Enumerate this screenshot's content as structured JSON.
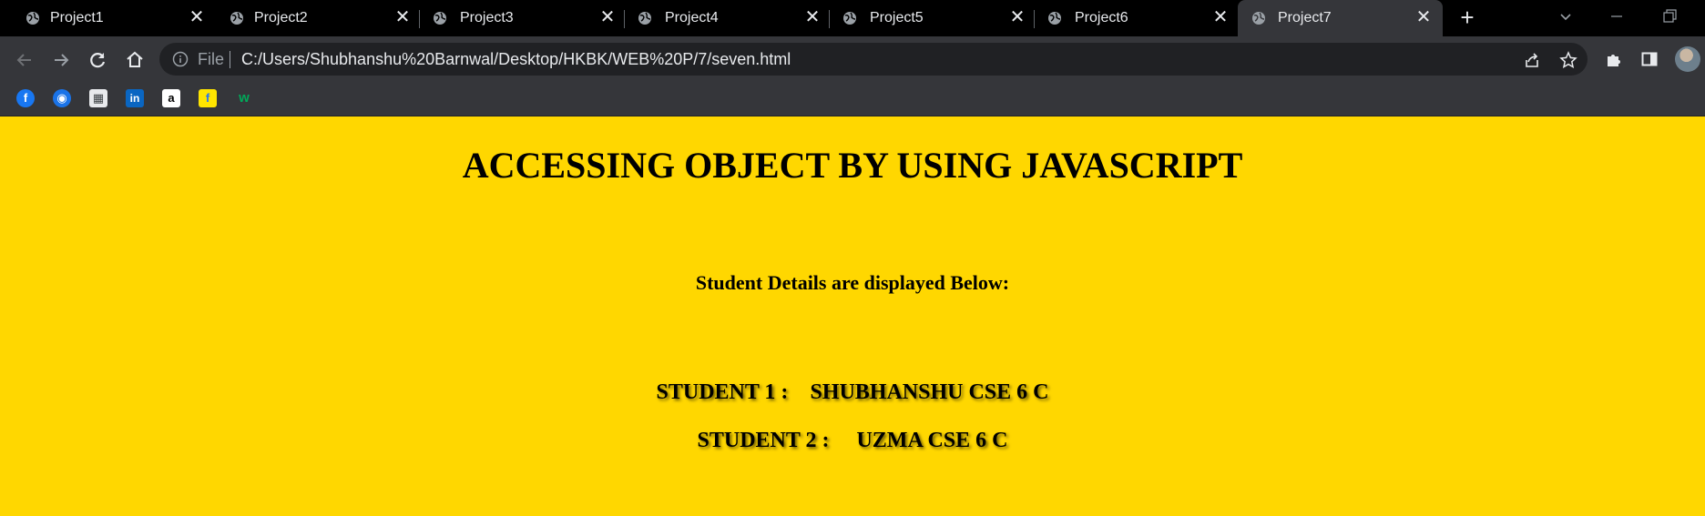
{
  "browser": {
    "tabs": [
      {
        "title": "Project1",
        "active": false
      },
      {
        "title": "Project2",
        "active": false
      },
      {
        "title": "Project3",
        "active": false
      },
      {
        "title": "Project4",
        "active": false
      },
      {
        "title": "Project5",
        "active": false
      },
      {
        "title": "Project6",
        "active": false
      },
      {
        "title": "Project7",
        "active": true
      }
    ],
    "new_tab_label": "+",
    "close_label": "✕",
    "address_bar": {
      "scheme_label": "File",
      "url": "C:/Users/Shubhanshu%20Barnwal/Desktop/HKBK/WEB%20P/7/seven.html"
    },
    "bookmarks": [
      {
        "icon": "facebook-icon",
        "glyph": "f",
        "color": "#1877f2"
      },
      {
        "icon": "bookmark-blue-icon",
        "glyph": "◉",
        "color": "#1a73e8"
      },
      {
        "icon": "bookmark-grid-icon",
        "glyph": "▦",
        "color": "#e8eaed"
      },
      {
        "icon": "linkedin-icon",
        "glyph": "in",
        "color": "#0a66c2"
      },
      {
        "icon": "amazon-icon",
        "glyph": "a",
        "color": "#ffffff"
      },
      {
        "icon": "flipkart-icon",
        "glyph": "f",
        "color": "#ffe500"
      },
      {
        "icon": "bookmark-w-icon",
        "glyph": "w",
        "color": "#00a859"
      }
    ],
    "colors": {
      "tabstrip": "#000000",
      "toolbar": "#35363a",
      "omnibox": "#202124",
      "page_background": "#ffd700"
    }
  },
  "page": {
    "heading": "ACCESSING OBJECT BY USING JAVASCRIPT",
    "subtext": "Student Details are displayed Below:",
    "students": [
      {
        "label": "STUDENT 1 :",
        "value": "SHUBHANSHU CSE 6 C"
      },
      {
        "label": "STUDENT 2 :",
        "value": "UZMA CSE 6 C"
      }
    ]
  }
}
